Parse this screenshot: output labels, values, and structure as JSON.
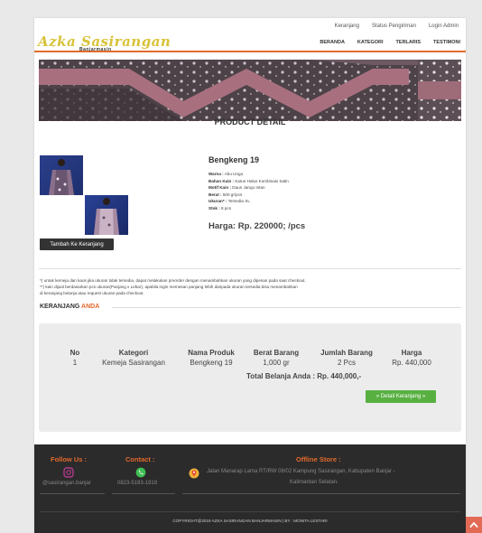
{
  "topnav": [
    "Keranjang",
    "Status Pengiriman",
    "Login Admin"
  ],
  "logo": {
    "title": "Azka Sasirangan",
    "sub": "Banjarmasin"
  },
  "menu": [
    "BERANDA",
    "KATEGORI",
    "TERLARIS",
    "TESTIMONI"
  ],
  "section_title": "PRODUCT DETAIL",
  "product": {
    "name": "Bengkeng 19",
    "attrs": [
      {
        "label": "Warna :",
        "value": "Abu Ungu"
      },
      {
        "label": "Bahan Kain :",
        "value": "Katun Halus Kombinasi Satin"
      },
      {
        "label": "Motif Kain :",
        "value": "Daun Jaruju Intan"
      },
      {
        "label": "Berat :",
        "value": "500 gr/pcs"
      },
      {
        "label": "Ukuran* :",
        "value": "Tersedia XL"
      },
      {
        "label": "Stok :",
        "value": "8 pcs"
      }
    ],
    "price": "Harga: Rp. 220000; /pcs",
    "add_to_cart": "Tambah Ke Keranjang"
  },
  "notes": [
    "*) untuk kemeja dan kaos jika ukuran tidak tersedia, dapat melakukan preorder dengan menambahkan ukuran yang dipesan pada saat checkout.",
    "**) kain dijual berdasarkan pcs ukuran(Panjang x Lebar), apabila ingin memesan panjang lebih daripada ukuran tersedia bisa menambahkan",
    "di keranjang belanja atau request ukuran pada checkout."
  ],
  "cart": {
    "title_main": "KERANJANG",
    "title_accent": "ANDA",
    "headers": [
      "No",
      "Kategori",
      "Nama Produk",
      "Berat Barang",
      "Jumlah Barang",
      "Harga"
    ],
    "rows": [
      [
        "1",
        "Kemeja Sasirangan",
        "Bengkeng 19",
        "1,000 gr",
        "2 Pcs",
        "Rp. 440,000"
      ]
    ],
    "total": "Total Belanja Anda : Rp. 440,000,-",
    "detail_button": "» Detail Keranjang »"
  },
  "footer": {
    "follow_title": "Follow Us :",
    "follow_handle": "@sasirangan.banjar",
    "contact_title": "Contact :",
    "contact_phone": "0823-5193-1919",
    "store_title": "Offline Store :",
    "store_line1": "Jalan Manarap Lama RT/RW 08/02 Kampung Sasirangan, Kabupaten Banjar -",
    "store_line2": "Kalimantan Selatan.",
    "copyright": "COPYRIGHT@2019 AZKA SASIRANGAN BANJARMASIN | BY : MONITA LESTARI"
  },
  "colors": {
    "accent": "#e26a2c",
    "green": "#58b041",
    "footer_bg": "#2b2b2b"
  },
  "icons": [
    "instagram-icon",
    "whatsapp-icon",
    "location-pin-icon",
    "chevron-up-icon"
  ]
}
